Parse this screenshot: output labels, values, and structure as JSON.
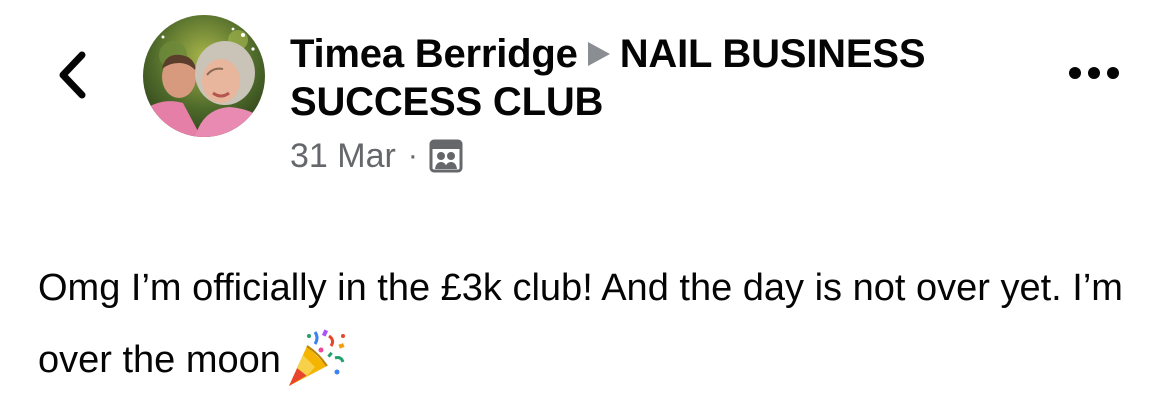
{
  "header": {
    "back_icon": "chevron-left-icon",
    "author": "Timea Berridge",
    "separator_icon": "triangle-right-icon",
    "group_name": "NAIL BUSINESS SUCCESS CLUB",
    "date": "31 Mar",
    "dot": "·",
    "audience_icon": "group-photo-icon",
    "more_icon": "more-horizontal-icon"
  },
  "post": {
    "text": "Omg I’m officially in the £3k club! And the day is not over yet. I’m over the moon",
    "emoji_icon": "party-popper-icon"
  },
  "colors": {
    "text_primary": "#050505",
    "text_secondary": "#65676b",
    "background": "#ffffff"
  }
}
